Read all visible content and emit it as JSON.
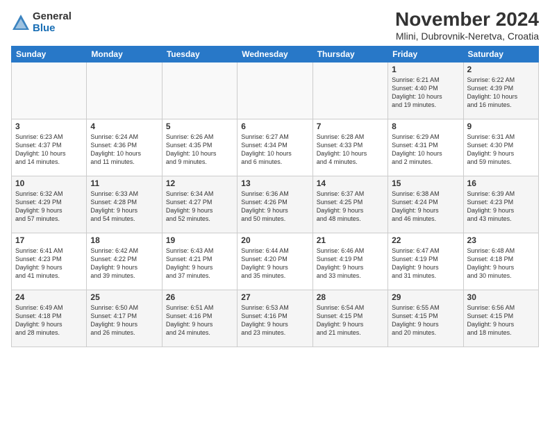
{
  "header": {
    "logo_general": "General",
    "logo_blue": "Blue",
    "title": "November 2024",
    "location": "Mlini, Dubrovnik-Neretva, Croatia"
  },
  "calendar": {
    "headers": [
      "Sunday",
      "Monday",
      "Tuesday",
      "Wednesday",
      "Thursday",
      "Friday",
      "Saturday"
    ],
    "weeks": [
      [
        {
          "day": "",
          "info": ""
        },
        {
          "day": "",
          "info": ""
        },
        {
          "day": "",
          "info": ""
        },
        {
          "day": "",
          "info": ""
        },
        {
          "day": "",
          "info": ""
        },
        {
          "day": "1",
          "info": "Sunrise: 6:21 AM\nSunset: 4:40 PM\nDaylight: 10 hours\nand 19 minutes."
        },
        {
          "day": "2",
          "info": "Sunrise: 6:22 AM\nSunset: 4:39 PM\nDaylight: 10 hours\nand 16 minutes."
        }
      ],
      [
        {
          "day": "3",
          "info": "Sunrise: 6:23 AM\nSunset: 4:37 PM\nDaylight: 10 hours\nand 14 minutes."
        },
        {
          "day": "4",
          "info": "Sunrise: 6:24 AM\nSunset: 4:36 PM\nDaylight: 10 hours\nand 11 minutes."
        },
        {
          "day": "5",
          "info": "Sunrise: 6:26 AM\nSunset: 4:35 PM\nDaylight: 10 hours\nand 9 minutes."
        },
        {
          "day": "6",
          "info": "Sunrise: 6:27 AM\nSunset: 4:34 PM\nDaylight: 10 hours\nand 6 minutes."
        },
        {
          "day": "7",
          "info": "Sunrise: 6:28 AM\nSunset: 4:33 PM\nDaylight: 10 hours\nand 4 minutes."
        },
        {
          "day": "8",
          "info": "Sunrise: 6:29 AM\nSunset: 4:31 PM\nDaylight: 10 hours\nand 2 minutes."
        },
        {
          "day": "9",
          "info": "Sunrise: 6:31 AM\nSunset: 4:30 PM\nDaylight: 9 hours\nand 59 minutes."
        }
      ],
      [
        {
          "day": "10",
          "info": "Sunrise: 6:32 AM\nSunset: 4:29 PM\nDaylight: 9 hours\nand 57 minutes."
        },
        {
          "day": "11",
          "info": "Sunrise: 6:33 AM\nSunset: 4:28 PM\nDaylight: 9 hours\nand 54 minutes."
        },
        {
          "day": "12",
          "info": "Sunrise: 6:34 AM\nSunset: 4:27 PM\nDaylight: 9 hours\nand 52 minutes."
        },
        {
          "day": "13",
          "info": "Sunrise: 6:36 AM\nSunset: 4:26 PM\nDaylight: 9 hours\nand 50 minutes."
        },
        {
          "day": "14",
          "info": "Sunrise: 6:37 AM\nSunset: 4:25 PM\nDaylight: 9 hours\nand 48 minutes."
        },
        {
          "day": "15",
          "info": "Sunrise: 6:38 AM\nSunset: 4:24 PM\nDaylight: 9 hours\nand 46 minutes."
        },
        {
          "day": "16",
          "info": "Sunrise: 6:39 AM\nSunset: 4:23 PM\nDaylight: 9 hours\nand 43 minutes."
        }
      ],
      [
        {
          "day": "17",
          "info": "Sunrise: 6:41 AM\nSunset: 4:23 PM\nDaylight: 9 hours\nand 41 minutes."
        },
        {
          "day": "18",
          "info": "Sunrise: 6:42 AM\nSunset: 4:22 PM\nDaylight: 9 hours\nand 39 minutes."
        },
        {
          "day": "19",
          "info": "Sunrise: 6:43 AM\nSunset: 4:21 PM\nDaylight: 9 hours\nand 37 minutes."
        },
        {
          "day": "20",
          "info": "Sunrise: 6:44 AM\nSunset: 4:20 PM\nDaylight: 9 hours\nand 35 minutes."
        },
        {
          "day": "21",
          "info": "Sunrise: 6:46 AM\nSunset: 4:19 PM\nDaylight: 9 hours\nand 33 minutes."
        },
        {
          "day": "22",
          "info": "Sunrise: 6:47 AM\nSunset: 4:19 PM\nDaylight: 9 hours\nand 31 minutes."
        },
        {
          "day": "23",
          "info": "Sunrise: 6:48 AM\nSunset: 4:18 PM\nDaylight: 9 hours\nand 30 minutes."
        }
      ],
      [
        {
          "day": "24",
          "info": "Sunrise: 6:49 AM\nSunset: 4:18 PM\nDaylight: 9 hours\nand 28 minutes."
        },
        {
          "day": "25",
          "info": "Sunrise: 6:50 AM\nSunset: 4:17 PM\nDaylight: 9 hours\nand 26 minutes."
        },
        {
          "day": "26",
          "info": "Sunrise: 6:51 AM\nSunset: 4:16 PM\nDaylight: 9 hours\nand 24 minutes."
        },
        {
          "day": "27",
          "info": "Sunrise: 6:53 AM\nSunset: 4:16 PM\nDaylight: 9 hours\nand 23 minutes."
        },
        {
          "day": "28",
          "info": "Sunrise: 6:54 AM\nSunset: 4:15 PM\nDaylight: 9 hours\nand 21 minutes."
        },
        {
          "day": "29",
          "info": "Sunrise: 6:55 AM\nSunset: 4:15 PM\nDaylight: 9 hours\nand 20 minutes."
        },
        {
          "day": "30",
          "info": "Sunrise: 6:56 AM\nSunset: 4:15 PM\nDaylight: 9 hours\nand 18 minutes."
        }
      ]
    ]
  }
}
